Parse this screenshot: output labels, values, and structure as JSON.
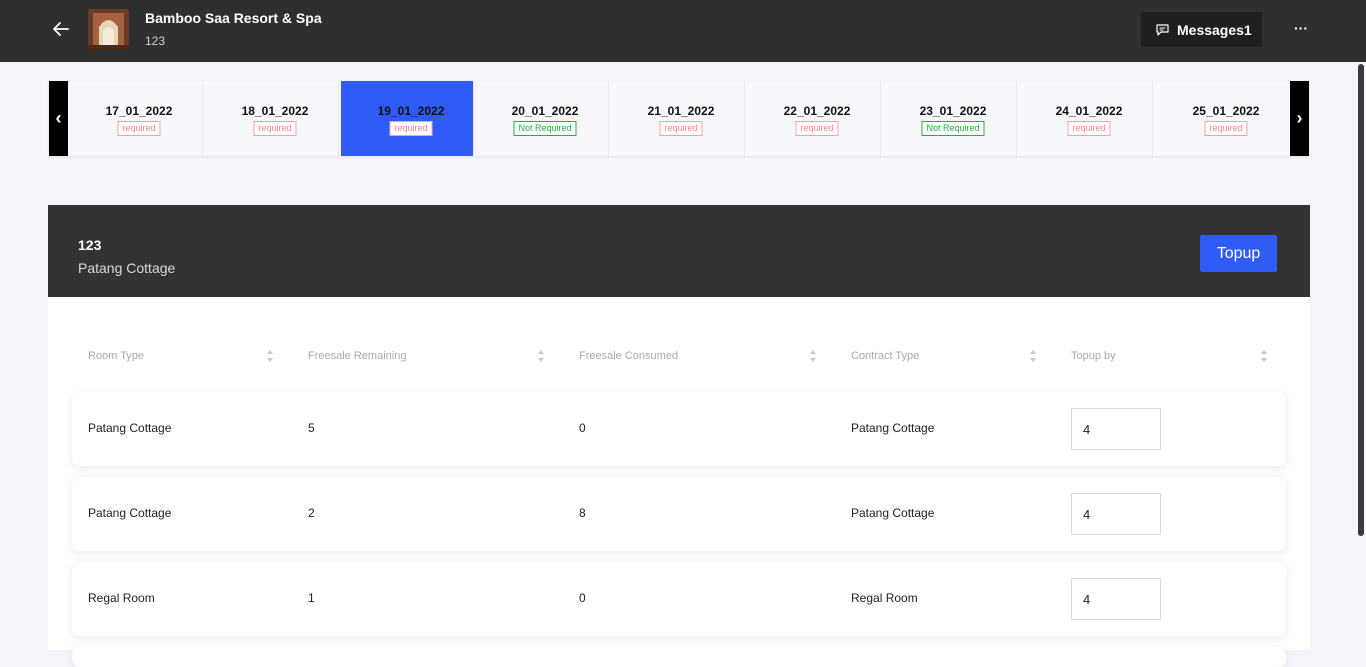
{
  "header": {
    "hotel_name": "Bamboo Saa Resort & Spa",
    "hotel_code": "123",
    "messages_label": "Messages1",
    "more_label": "···"
  },
  "date_strip": {
    "prev_label": "‹",
    "next_label": "›",
    "dates": [
      {
        "label": "17_01_2022",
        "status": "required"
      },
      {
        "label": "18_01_2022",
        "status": "required"
      },
      {
        "label": "19_01_2022",
        "status": "required",
        "active": true
      },
      {
        "label": "20_01_2022",
        "status": "Not Required"
      },
      {
        "label": "21_01_2022",
        "status": "required"
      },
      {
        "label": "22_01_2022",
        "status": "required"
      },
      {
        "label": "23_01_2022",
        "status": "Not Required"
      },
      {
        "label": "24_01_2022",
        "status": "required"
      },
      {
        "label": "25_01_2022",
        "status": "required"
      }
    ]
  },
  "card": {
    "code": "123",
    "room_name": "Patang Cottage",
    "topup_label": "Topup",
    "columns": [
      "Room Type",
      "Freesale Remaining",
      "Freesale Consumed",
      "Contract Type",
      "Topup by"
    ],
    "rows": [
      {
        "room_type": "Patang Cottage",
        "remaining": "5",
        "consumed": "0",
        "contract": "Patang Cottage",
        "topup": "4"
      },
      {
        "room_type": "Patang Cottage",
        "remaining": "2",
        "consumed": "8",
        "contract": "Patang Cottage",
        "topup": "4"
      },
      {
        "room_type": "Regal Room",
        "remaining": "1",
        "consumed": "0",
        "contract": "Regal Room",
        "topup": "4"
      }
    ]
  },
  "colors": {
    "accent": "#2f5bf6",
    "header_bg": "#2f2f2f",
    "required": "#e88a8a",
    "not_required": "#2ea84a"
  }
}
